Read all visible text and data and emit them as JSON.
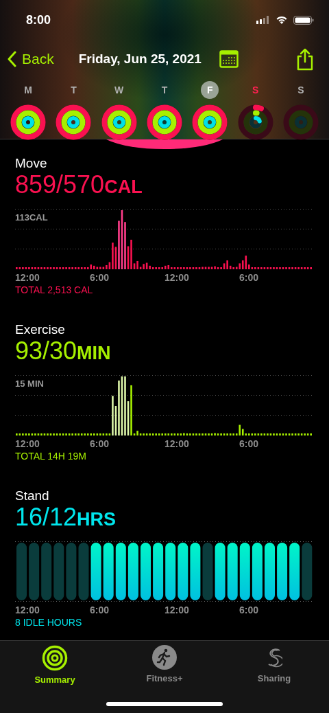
{
  "status_bar": {
    "time": "8:00"
  },
  "nav": {
    "back": "Back",
    "title": "Friday, Jun 25, 2021"
  },
  "week": [
    {
      "letter": "M",
      "selected": false,
      "today": false,
      "kind": "closed"
    },
    {
      "letter": "T",
      "selected": false,
      "today": false,
      "kind": "closed"
    },
    {
      "letter": "W",
      "selected": false,
      "today": false,
      "kind": "closed"
    },
    {
      "letter": "T",
      "selected": false,
      "today": false,
      "kind": "closed"
    },
    {
      "letter": "F",
      "selected": true,
      "today": false,
      "kind": "closed"
    },
    {
      "letter": "S",
      "selected": false,
      "today": true,
      "kind": "started"
    },
    {
      "letter": "S",
      "selected": false,
      "today": false,
      "kind": "empty"
    }
  ],
  "sections": [
    {
      "kind": "move",
      "title": "Move",
      "value": "859/570",
      "unit": "CAL",
      "scale_label": "113CAL",
      "axis_labels": [
        "12:00",
        "6:00",
        "12:00",
        "6:00"
      ],
      "total": "TOTAL 2,513 CAL"
    },
    {
      "kind": "exercise",
      "title": "Exercise",
      "value": "93/30",
      "unit": "MIN",
      "scale_label": "15 MIN",
      "axis_labels": [
        "12:00",
        "6:00",
        "12:00",
        "6:00"
      ],
      "total": "TOTAL 14H 19M"
    },
    {
      "kind": "stand",
      "title": "Stand",
      "value": "16/12",
      "unit": "HRS",
      "axis_labels": [
        "12:00",
        "6:00",
        "12:00",
        "6:00"
      ],
      "total": "8 IDLE HOURS",
      "hours": [
        {
          "stood": false
        },
        {
          "stood": false
        },
        {
          "stood": false
        },
        {
          "stood": false
        },
        {
          "stood": false
        },
        {
          "stood": false
        },
        {
          "stood": true
        },
        {
          "stood": true
        },
        {
          "stood": true
        },
        {
          "stood": true
        },
        {
          "stood": true
        },
        {
          "stood": true
        },
        {
          "stood": true
        },
        {
          "stood": true
        },
        {
          "stood": true
        },
        {
          "stood": false
        },
        {
          "stood": true
        },
        {
          "stood": true
        },
        {
          "stood": true
        },
        {
          "stood": true
        },
        {
          "stood": true
        },
        {
          "stood": true
        },
        {
          "stood": true
        },
        {
          "stood": false
        }
      ]
    }
  ],
  "tabs": [
    {
      "kind": "summary",
      "label": "Summary",
      "selected": true
    },
    {
      "kind": "fitness",
      "label": "Fitness+",
      "selected": false
    },
    {
      "kind": "sharing",
      "label": "Sharing",
      "selected": false
    }
  ]
}
